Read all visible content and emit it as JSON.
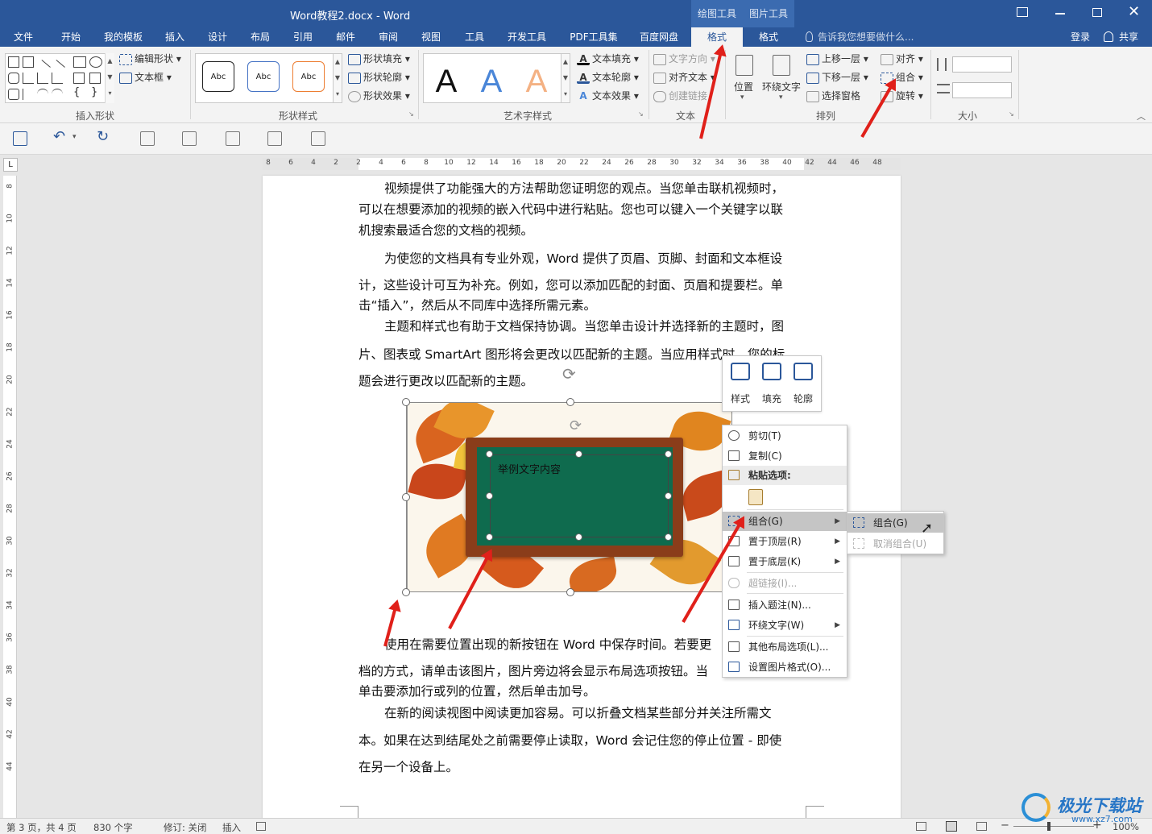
{
  "window": {
    "title": "Word教程2.docx - Word",
    "context_tools": [
      "绘图工具",
      "图片工具"
    ],
    "controls": [
      "restore-ribbon",
      "minimize",
      "maximize",
      "close"
    ]
  },
  "menu": {
    "tabs": [
      "文件",
      "开始",
      "我的模板",
      "插入",
      "设计",
      "布局",
      "引用",
      "邮件",
      "审阅",
      "视图",
      "工具",
      "开发工具",
      "PDF工具集",
      "百度网盘"
    ],
    "format_tab_1": "格式",
    "format_tab_2": "格式",
    "tell_me": "告诉我您想要做什么...",
    "login": "登录",
    "share": "共享"
  },
  "ribbon": {
    "insert_shapes": {
      "label": "插入形状",
      "edit_shape": "编辑形状",
      "text_box": "文本框"
    },
    "shape_styles": {
      "label": "形状样式",
      "sample": "Abc",
      "fill": "形状填充",
      "outline": "形状轮廓",
      "effect": "形状效果"
    },
    "wordart": {
      "label": "艺术字样式",
      "sample": "A",
      "fill": "文本填充",
      "outline": "文本轮廓",
      "effect": "文本效果"
    },
    "text": {
      "label": "文本",
      "direction": "文字方向",
      "align": "对齐文本",
      "link": "创建链接"
    },
    "arrange": {
      "label": "排列",
      "position": "位置",
      "wrap": "环绕文字",
      "forward": "上移一层",
      "backward": "下移一层",
      "pane": "选择窗格",
      "align": "对齐",
      "group": "组合",
      "rotate": "旋转"
    },
    "size": {
      "label": "大小"
    }
  },
  "ruler": {
    "h_ticks": [
      "8",
      "6",
      "4",
      "2",
      "2",
      "4",
      "6",
      "8",
      "10",
      "12",
      "14",
      "16",
      "18",
      "20",
      "22",
      "24",
      "26",
      "28",
      "30",
      "32",
      "34",
      "36",
      "38",
      "40",
      "42",
      "44",
      "46",
      "48"
    ],
    "v_ticks": [
      "8",
      "10",
      "12",
      "14",
      "16",
      "18",
      "20",
      "22",
      "24",
      "26",
      "28",
      "30",
      "32",
      "34",
      "36",
      "38",
      "40",
      "42",
      "44"
    ]
  },
  "document": {
    "p1": [
      "视频提供了功能强大的方法帮助您证明您的观点。当您单击联机视频时，",
      "可以在想要添加的视频的嵌入代码中进行粘贴。您也可以键入一个关键字以联",
      "机搜索最适合您的文档的视频。"
    ],
    "p2": [
      "为使您的文档具有专业外观，Word 提供了页眉、页脚、封面和文本框设",
      "计，这些设计可互为补充。例如，您可以添加匹配的封面、页眉和提要栏。单",
      "击“插入”，然后从不同库中选择所需元素。"
    ],
    "p3": [
      "主题和样式也有助于文档保持协调。当您单击设计并选择新的主题时，图",
      "片、图表或 SmartArt 图形将会更改以匹配新的主题。当应用样式时，您的标",
      "题会进行更改以匹配新的主题。"
    ],
    "p4": [
      "使用在需要位置出现的新按钮在 Word 中保存时间。若要更",
      "档的方式，请单击该图片，图片旁边将会显示布局选项按钮。当",
      "单击要添加行或列的位置，然后单击加号。"
    ],
    "p5": [
      "在新的阅读视图中阅读更加容易。可以折叠文档某些部分并关注所需文",
      "本。如果在达到结尾处之前需要停止读取，Word 会记住您的停止位置 - 即使",
      "在另一个设备上。"
    ],
    "textbox_text": "举例文字内容"
  },
  "mini_toolbar": {
    "style": "样式",
    "fill": "填充",
    "outline": "轮廓"
  },
  "context_menu": {
    "cut": "剪切(T)",
    "copy": "复制(C)",
    "paste_options": "粘贴选项:",
    "group": "组合(G)",
    "bring_front": "置于顶层(R)",
    "send_back": "置于底层(K)",
    "hyperlink": "超链接(I)...",
    "caption": "插入题注(N)...",
    "wrap": "环绕文字(W)",
    "layout_more": "其他布局选项(L)...",
    "format_picture": "设置图片格式(O)..."
  },
  "submenu": {
    "group": "组合(G)",
    "ungroup": "取消组合(U)"
  },
  "status": {
    "page": "第 3 页，共 4 页",
    "words": "830 个字",
    "track": "修订: 关闭",
    "mode": "插入",
    "zoom": "100%"
  },
  "watermark": {
    "brand": "极光下载站",
    "url": "www.xz7.com"
  },
  "colors": {
    "accent": "#2b579a",
    "annotation_arrow": "#e0201a",
    "board": "#0f6b4e"
  }
}
